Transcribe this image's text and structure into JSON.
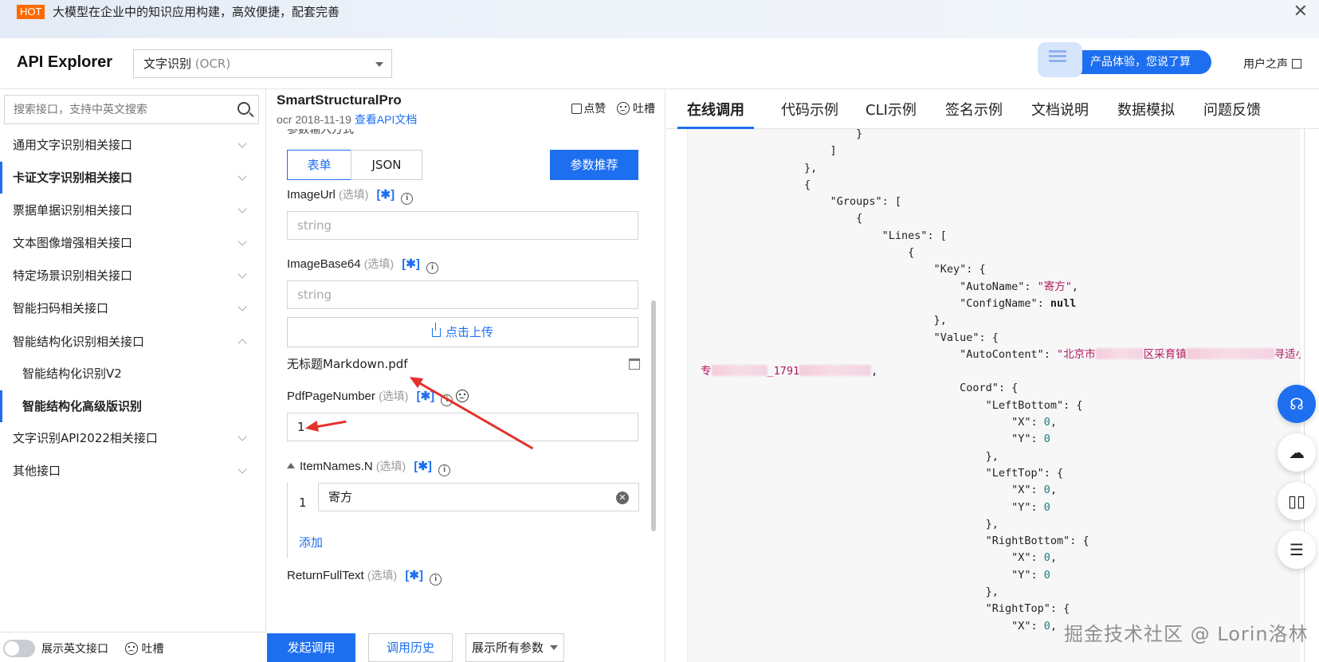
{
  "banner": {
    "badge": "HOT",
    "text": "大模型在企业中的知识应用构建，高效便捷，配套完善",
    "close": "✕"
  },
  "header": {
    "logo": "API Explorer",
    "product_name": "文字识别",
    "product_code": "(OCR)",
    "promo": "产品体验，您说了算",
    "user_voice": "用户之声"
  },
  "sidebar": {
    "search_placeholder": "搜索接口，支持中英文搜索",
    "items": [
      {
        "label": "通用文字识别相关接口"
      },
      {
        "label": "卡证文字识别相关接口"
      },
      {
        "label": "票据单据识别相关接口"
      },
      {
        "label": "文本图像增强相关接口"
      },
      {
        "label": "特定场景识别相关接口"
      },
      {
        "label": "智能扫码相关接口"
      },
      {
        "label": "智能结构化识别相关接口"
      },
      {
        "label": "智能结构化识别V2"
      },
      {
        "label": "智能结构化高级版识别"
      },
      {
        "label": "文字识别API2022相关接口"
      },
      {
        "label": "其他接口"
      }
    ],
    "footer": {
      "toggle_label": "展示英文接口",
      "feedback": "吐槽"
    }
  },
  "middle": {
    "title": "SmartStructuralPro",
    "subtitle": "ocr 2018-11-19",
    "doc_link": "查看API文档",
    "like": "点赞",
    "complain": "吐槽",
    "cut_label": "参数输入方式",
    "tab_form": "表单",
    "tab_json": "JSON",
    "recommend": "参数推荐",
    "fields": {
      "image_url": {
        "label": "ImageUrl",
        "opt": "(选填)",
        "placeholder": "string"
      },
      "image_base64": {
        "label": "ImageBase64",
        "opt": "(选填)",
        "placeholder": "string"
      },
      "upload": "点击上传",
      "filename": "无标题Markdown.pdf",
      "pdf_page": {
        "label": "PdfPageNumber",
        "opt": "(选填)",
        "value": "1"
      },
      "item_names": {
        "label": "ItemNames.N",
        "opt": "(选填)",
        "index": "1",
        "value": "寄方",
        "add": "添加"
      },
      "return_full": {
        "label": "ReturnFullText",
        "opt": "(选填)"
      }
    },
    "star": "[✱]",
    "info": "i",
    "footer": {
      "invoke": "发起调用",
      "history": "调用历史",
      "show_all": "展示所有参数"
    }
  },
  "right": {
    "tabs": [
      {
        "label": "在线调用"
      },
      {
        "label": "代码示例"
      },
      {
        "label": "CLI示例"
      },
      {
        "label": "签名示例"
      },
      {
        "label": "文档说明"
      },
      {
        "label": "数据模拟"
      },
      {
        "label": "问题反馈"
      }
    ],
    "code": {
      "groups_key": "\"Groups\"",
      "lines_key": "\"Lines\"",
      "key_key": "\"Key\"",
      "autoname_key": "\"AutoName\"",
      "autoname_val": "\"寄方\"",
      "configname_key": "\"ConfigName\"",
      "null": "null",
      "value_key": "\"Value\"",
      "autocontent_key": "\"AutoContent\"",
      "autocontent_start": "\"北京市",
      "autocontent_mid": "区采育镇",
      "autocontent_mid2": "寻适小仓库",
      "line2_start": "专",
      "line2_mid": "_1791",
      "coord_key": "Coord\"",
      "leftbottom": "\"LeftBottom\"",
      "lefttop": "\"LeftTop\"",
      "rightbottom": "\"RightBottom\"",
      "righttop": "\"RightTop\"",
      "x": "\"X\"",
      "y": "\"Y\"",
      "zero": "0"
    }
  },
  "watermark": "掘金技术社区 @ Lorin洛林"
}
